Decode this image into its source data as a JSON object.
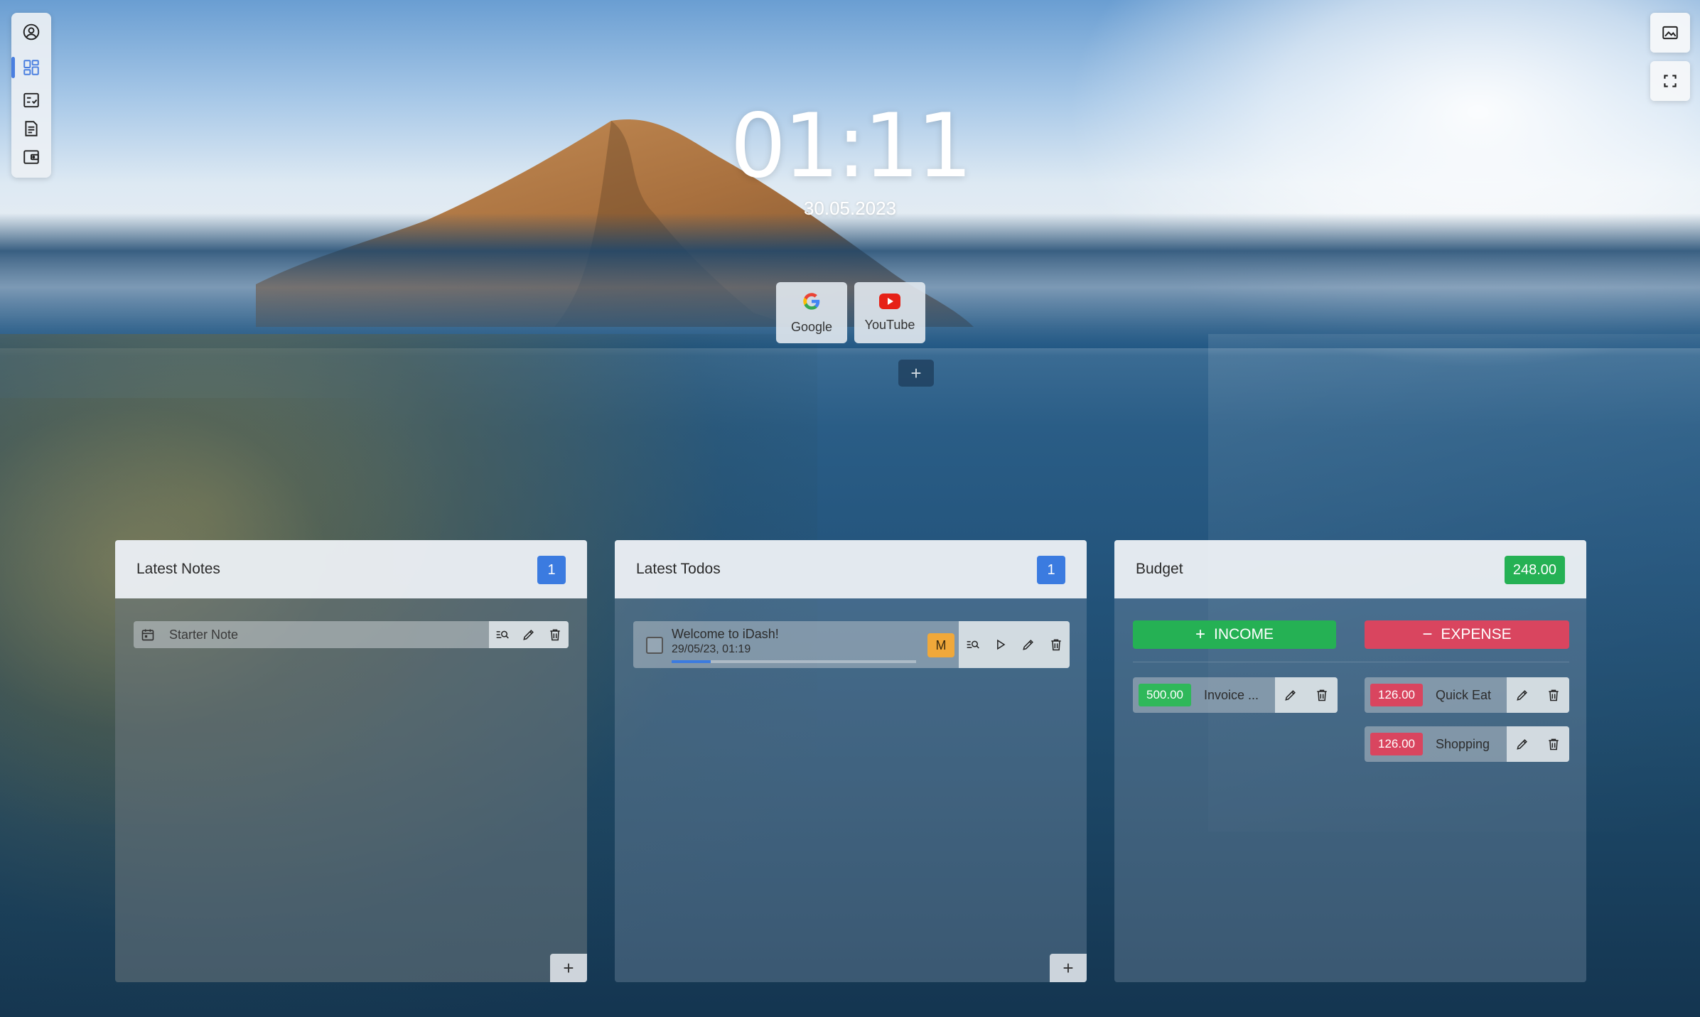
{
  "clock": {
    "time": "01:11",
    "date": "30.05.2023"
  },
  "sidebar": {
    "items": [
      {
        "name": "profile",
        "icon": "user-circle-icon"
      },
      {
        "name": "dashboard",
        "icon": "dashboard-icon",
        "active": true
      },
      {
        "name": "todos",
        "icon": "checklist-icon"
      },
      {
        "name": "notes",
        "icon": "document-icon"
      },
      {
        "name": "budget",
        "icon": "wallet-icon"
      }
    ]
  },
  "top_right": [
    {
      "name": "wallpaper",
      "icon": "image-icon"
    },
    {
      "name": "fullscreen",
      "icon": "fullscreen-icon"
    }
  ],
  "shortcuts": [
    {
      "label": "Google",
      "icon": "google-icon"
    },
    {
      "label": "YouTube",
      "icon": "youtube-icon"
    }
  ],
  "add_shortcut_label": "+",
  "notes_panel": {
    "title": "Latest Notes",
    "count": "1",
    "items": [
      {
        "title": "Starter Note"
      }
    ],
    "add_label": "+"
  },
  "todos_panel": {
    "title": "Latest Todos",
    "count": "1",
    "items": [
      {
        "title": "Welcome to iDash!",
        "date": "29/05/23, 01:19",
        "priority": "M",
        "progress": 0.16
      }
    ],
    "add_label": "+"
  },
  "budget_panel": {
    "title": "Budget",
    "total": "248.00",
    "income_label": "INCOME",
    "expense_label": "EXPENSE",
    "income": [
      {
        "amount": "500.00",
        "name": "Invoice ..."
      }
    ],
    "expenses": [
      {
        "amount": "126.00",
        "name": "Quick Eat"
      },
      {
        "amount": "126.00",
        "name": "Shopping"
      }
    ]
  },
  "colors": {
    "accent_blue": "#3b7be0",
    "income_green": "#25b154",
    "expense_red": "#d9455f",
    "priority_orange": "#f0a83a"
  }
}
